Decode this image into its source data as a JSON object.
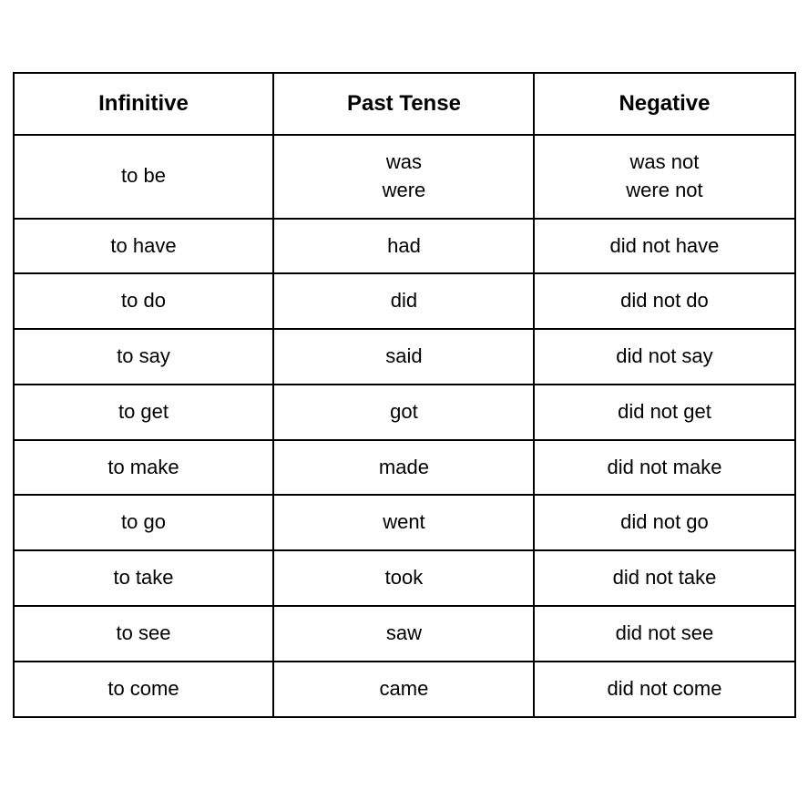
{
  "table": {
    "headers": [
      {
        "id": "infinitive",
        "label": "Infinitive"
      },
      {
        "id": "past-tense",
        "label": "Past Tense"
      },
      {
        "id": "negative",
        "label": "Negative"
      }
    ],
    "rows": [
      {
        "infinitive": "to be",
        "past_tense": "was\nwere",
        "negative": "was not\nwere not"
      },
      {
        "infinitive": "to have",
        "past_tense": "had",
        "negative": "did not have"
      },
      {
        "infinitive": "to do",
        "past_tense": "did",
        "negative": "did not do"
      },
      {
        "infinitive": "to say",
        "past_tense": "said",
        "negative": "did not say"
      },
      {
        "infinitive": "to get",
        "past_tense": "got",
        "negative": "did not get"
      },
      {
        "infinitive": "to make",
        "past_tense": "made",
        "negative": "did not make"
      },
      {
        "infinitive": "to go",
        "past_tense": "went",
        "negative": "did not go"
      },
      {
        "infinitive": "to take",
        "past_tense": "took",
        "negative": "did not take"
      },
      {
        "infinitive": "to see",
        "past_tense": "saw",
        "negative": "did not see"
      },
      {
        "infinitive": "to come",
        "past_tense": "came",
        "negative": "did not come"
      }
    ]
  }
}
